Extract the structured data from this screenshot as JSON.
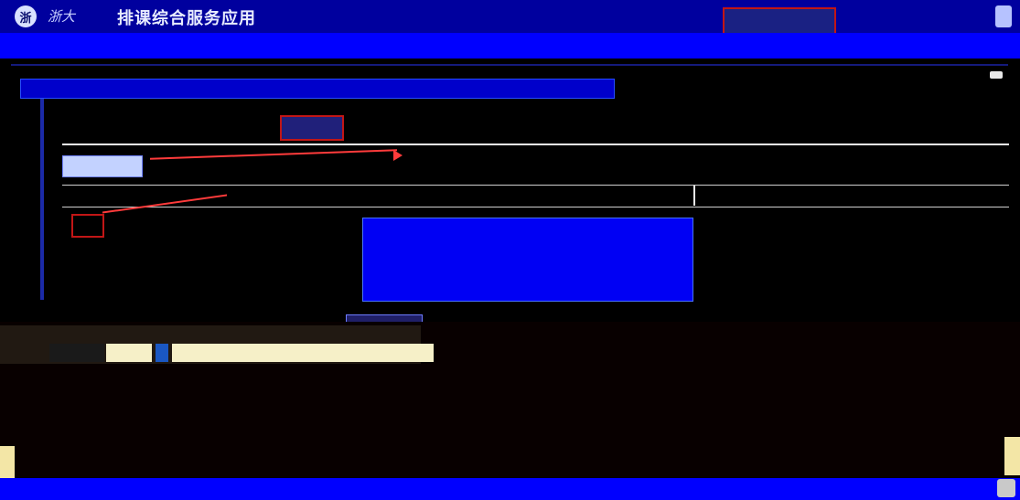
{
  "header": {
    "school": "浙大",
    "app_title": "排课综合服务应用",
    "button_label": "",
    "link_label": "",
    "user_name": ""
  },
  "secondary": {
    "text": ""
  },
  "notice": {
    "text": ""
  },
  "tabs": [
    {
      "label": ""
    },
    {
      "label": ""
    },
    {
      "label": ""
    },
    {
      "label": ""
    },
    {
      "label": ""
    }
  ],
  "search": {
    "chip_label": ""
  },
  "tips": {
    "tip1": ""
  },
  "table": {
    "headers": [
      "",
      "",
      "",
      ""
    ]
  },
  "dropdown": {
    "items": [
      "",
      "",
      "",
      "",
      ""
    ]
  },
  "footer": {
    "chip_label": "",
    "progress_text": ""
  },
  "status": {
    "text": ""
  }
}
